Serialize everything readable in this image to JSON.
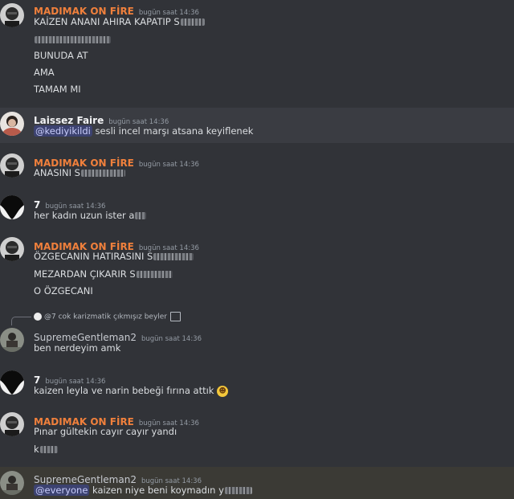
{
  "timestamp": "bugün saat 14:36",
  "messages": [
    {
      "author": "MADIMAK ON FİRE",
      "author_color": "#f0803c",
      "lines": [
        "KAİZEN ANANI AHIRA KAPATIP S",
        "",
        "BUNUDA AT",
        "AMA",
        "TAMAM MI"
      ]
    },
    {
      "author": "Laissez Faire",
      "author_color": "#f2f3f5",
      "mention": "@kediyikildi",
      "text": " sesli incel marşı atsana keyiflenek"
    },
    {
      "author": "MADIMAK ON FİRE",
      "author_color": "#f0803c",
      "lines": [
        "ANASINI S"
      ]
    },
    {
      "author": "7",
      "author_color": "#f2f3f5",
      "lines": [
        "her kadın uzun ister a"
      ]
    },
    {
      "author": "MADIMAK ON FİRE",
      "author_color": "#f0803c",
      "lines": [
        "ÖZGECANIN HATIRASINI S",
        "MEZARDAN ÇIKARIR S",
        "O ÖZGECANI"
      ]
    },
    {
      "reply_to": "@7 cok karizmatik çıkmışız beyler",
      "author": "SupremeGentleman2",
      "author_color": "#c7cad0",
      "lines": [
        "ben nerdeyim amk"
      ]
    },
    {
      "author": "7",
      "author_color": "#f2f3f5",
      "lines": [
        "kaizen leyla ve narin bebeği fırına attık"
      ]
    },
    {
      "author": "MADIMAK ON FİRE",
      "author_color": "#f0803c",
      "lines": [
        "Pınar gültekin cayır cayır yandı",
        "k"
      ]
    },
    {
      "author": "SupremeGentleman2",
      "author_color": "#c7cad0",
      "mention": "@everyone",
      "text": " kaizen niye beni koymadın y"
    }
  ]
}
